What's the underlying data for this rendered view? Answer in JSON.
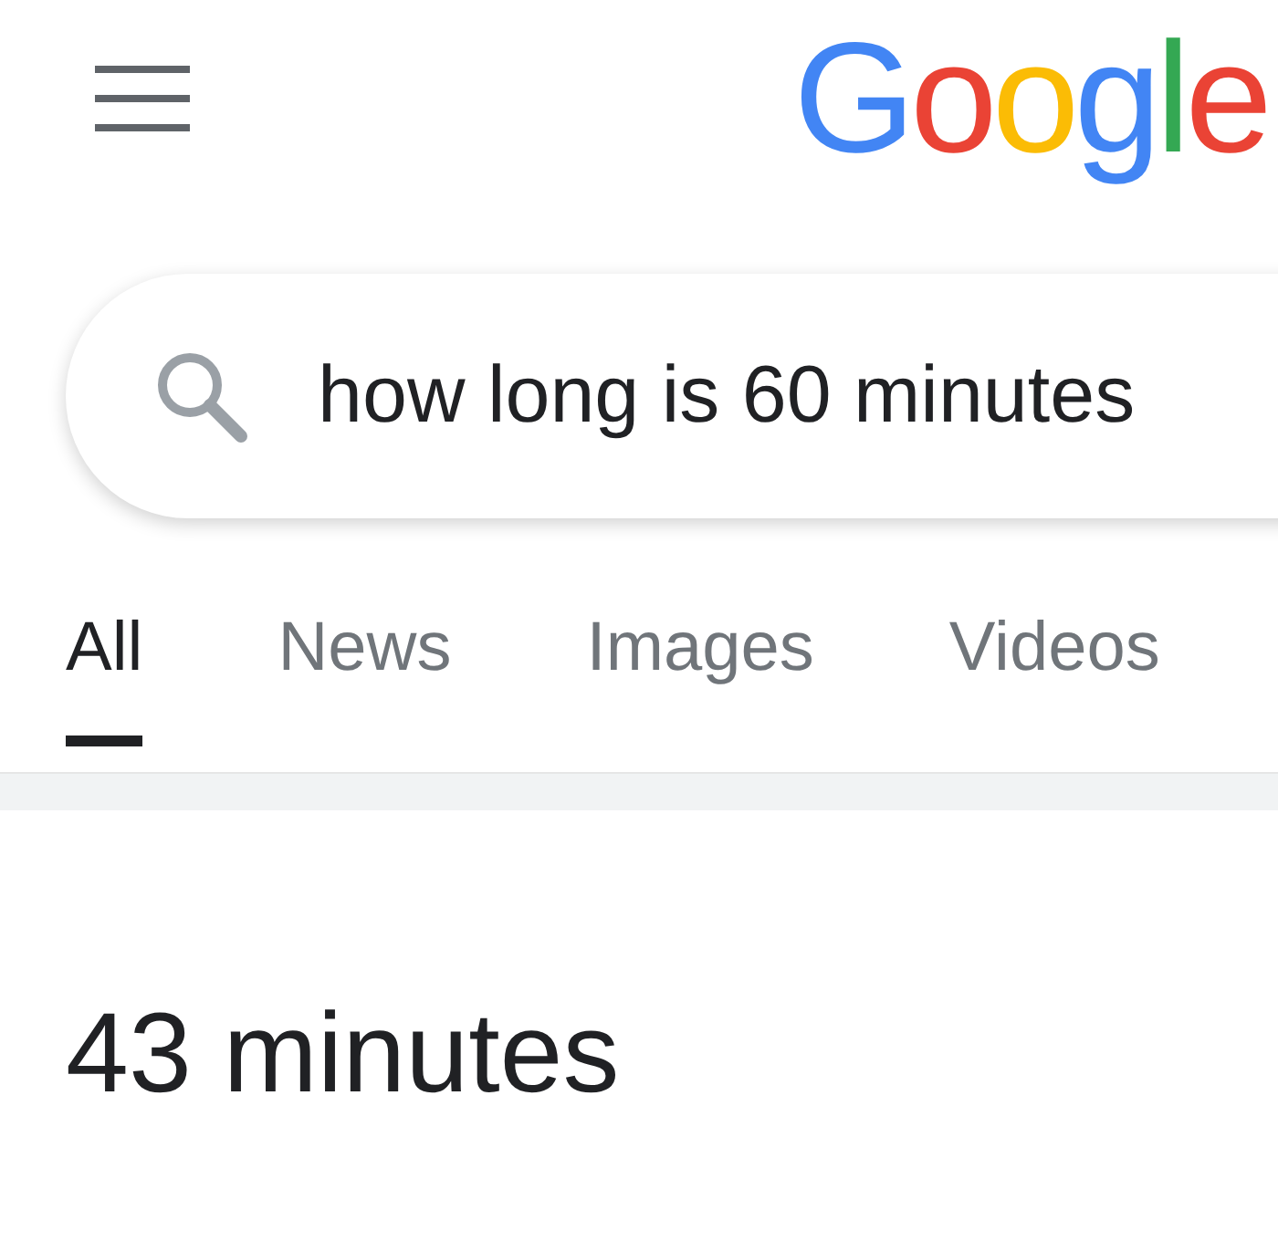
{
  "logo": {
    "letters": [
      {
        "text": "G",
        "color": "#4285f4"
      },
      {
        "text": "o",
        "color": "#ea4335"
      },
      {
        "text": "o",
        "color": "#fbbc05"
      },
      {
        "text": "g",
        "color": "#4285f4"
      },
      {
        "text": "l",
        "color": "#34a853"
      },
      {
        "text": "e",
        "color": "#ea4335"
      }
    ]
  },
  "search": {
    "value": "how long is 60 minutes"
  },
  "tabs": [
    {
      "label": "All",
      "selected": true
    },
    {
      "label": "News",
      "selected": false
    },
    {
      "label": "Images",
      "selected": false
    },
    {
      "label": "Videos",
      "selected": false
    }
  ],
  "answer": "43 minutes"
}
